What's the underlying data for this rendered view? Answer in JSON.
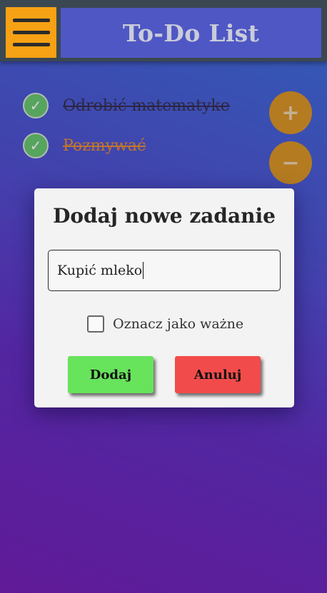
{
  "header": {
    "title": "To-Do List",
    "menu_icon": "hamburger-menu-icon"
  },
  "tasks": [
    {
      "label": "Odrobić matematyke",
      "done": true,
      "icon": "checkmark-icon"
    },
    {
      "label": "Pozmywać",
      "done": true,
      "icon": "checkmark-icon"
    }
  ],
  "actions": {
    "add_symbol": "+",
    "remove_symbol": "−"
  },
  "dialog": {
    "title": "Dodaj nowe zadanie",
    "input_value": "Kupić mleko",
    "important_label": "Oznacz jako ważne",
    "important_checked": false,
    "add_label": "Dodaj",
    "cancel_label": "Anuluj"
  },
  "colors": {
    "menu_accent": "#f7a114",
    "title_bar": "#4f57c5",
    "add_button": "#68e35c",
    "cancel_button": "#f24b4b",
    "fab": "#c98a1e"
  }
}
